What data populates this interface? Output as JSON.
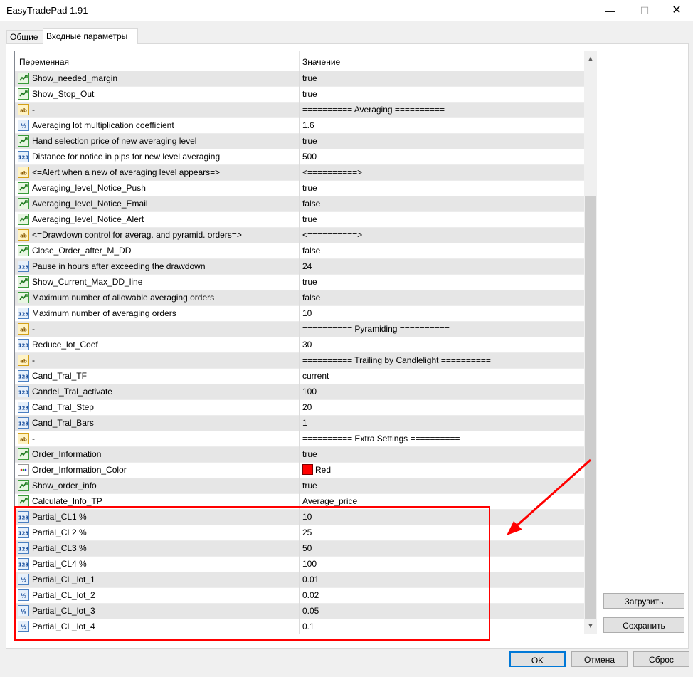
{
  "window": {
    "title": "EasyTradePad 1.91",
    "minimize": "—",
    "maximize": "☐",
    "close": "✕"
  },
  "tabs": [
    {
      "label": "Общие",
      "active": false
    },
    {
      "label": "Входные параметры",
      "active": true
    }
  ],
  "table": {
    "headers": {
      "variable": "Переменная",
      "value": "Значение"
    },
    "rows": [
      {
        "type": "bool",
        "name": "Show_needed_margin",
        "value": "true"
      },
      {
        "type": "bool",
        "name": "Show_Stop_Out",
        "value": "true"
      },
      {
        "type": "str",
        "name": "-",
        "value": "========== Averaging =========="
      },
      {
        "type": "dbl",
        "name": "Averaging lot multiplication coefficient",
        "value": "1.6"
      },
      {
        "type": "bool",
        "name": "Hand selection price of new averaging level",
        "value": "true"
      },
      {
        "type": "int",
        "name": "Distance for notice in pips for new level averaging",
        "value": "500"
      },
      {
        "type": "str",
        "name": "<=Alert when a new of averaging level appears=>",
        "value": "<==========>"
      },
      {
        "type": "bool",
        "name": "Averaging_level_Notice_Push",
        "value": "true"
      },
      {
        "type": "bool",
        "name": "Averaging_level_Notice_Email",
        "value": "false"
      },
      {
        "type": "bool",
        "name": "Averaging_level_Notice_Alert",
        "value": "true"
      },
      {
        "type": "str",
        "name": "<=Drawdown control for averag. and pyramid. orders=>",
        "value": "<==========>"
      },
      {
        "type": "bool",
        "name": "Close_Order_after_M_DD",
        "value": "false"
      },
      {
        "type": "int",
        "name": "Pause in hours after exceeding the drawdown",
        "value": "24"
      },
      {
        "type": "bool",
        "name": "Show_Current_Max_DD_line",
        "value": "true"
      },
      {
        "type": "bool",
        "name": "Maximum number of allowable averaging orders",
        "value": "false"
      },
      {
        "type": "int",
        "name": "Maximum number of averaging orders",
        "value": "10"
      },
      {
        "type": "str",
        "name": "-",
        "value": "========== Pyramiding =========="
      },
      {
        "type": "int",
        "name": "Reduce_lot_Coef",
        "value": "30"
      },
      {
        "type": "str",
        "name": "-",
        "value": "========== Trailing by Candlelight =========="
      },
      {
        "type": "int",
        "name": "Cand_Tral_TF",
        "value": "current"
      },
      {
        "type": "int",
        "name": "Candel_Tral_activate",
        "value": "100"
      },
      {
        "type": "int",
        "name": "Cand_Tral_Step",
        "value": "20"
      },
      {
        "type": "int",
        "name": "Cand_Tral_Bars",
        "value": "1"
      },
      {
        "type": "str",
        "name": "-",
        "value": "========== Extra Settings =========="
      },
      {
        "type": "bool",
        "name": "Order_Information",
        "value": "true"
      },
      {
        "type": "color",
        "name": "Order_Information_Color",
        "value": "Red"
      },
      {
        "type": "bool",
        "name": "Show_order_info",
        "value": "true"
      },
      {
        "type": "bool",
        "name": "Calculate_Info_TP",
        "value": "Average_price"
      },
      {
        "type": "int",
        "name": "Partial_CL1 %",
        "value": "10"
      },
      {
        "type": "int",
        "name": "Partial_CL2 %",
        "value": "25"
      },
      {
        "type": "int",
        "name": "Partial_CL3 %",
        "value": "50"
      },
      {
        "type": "int",
        "name": "Partial_CL4 %",
        "value": "100"
      },
      {
        "type": "dbl",
        "name": "Partial_CL_lot_1",
        "value": "0.01"
      },
      {
        "type": "dbl",
        "name": "Partial_CL_lot_2",
        "value": "0.02"
      },
      {
        "type": "dbl",
        "name": "Partial_CL_lot_3",
        "value": "0.05"
      },
      {
        "type": "dbl",
        "name": "Partial_CL_lot_4",
        "value": "0.1"
      }
    ]
  },
  "colors": {
    "accent": "#0078d7",
    "highlight": "#ff0000",
    "swatch_red": "#ff0000"
  },
  "buttons": {
    "load": "Загрузить",
    "save": "Сохранить",
    "ok": "OK",
    "cancel": "Отмена",
    "reset": "Сброс"
  }
}
